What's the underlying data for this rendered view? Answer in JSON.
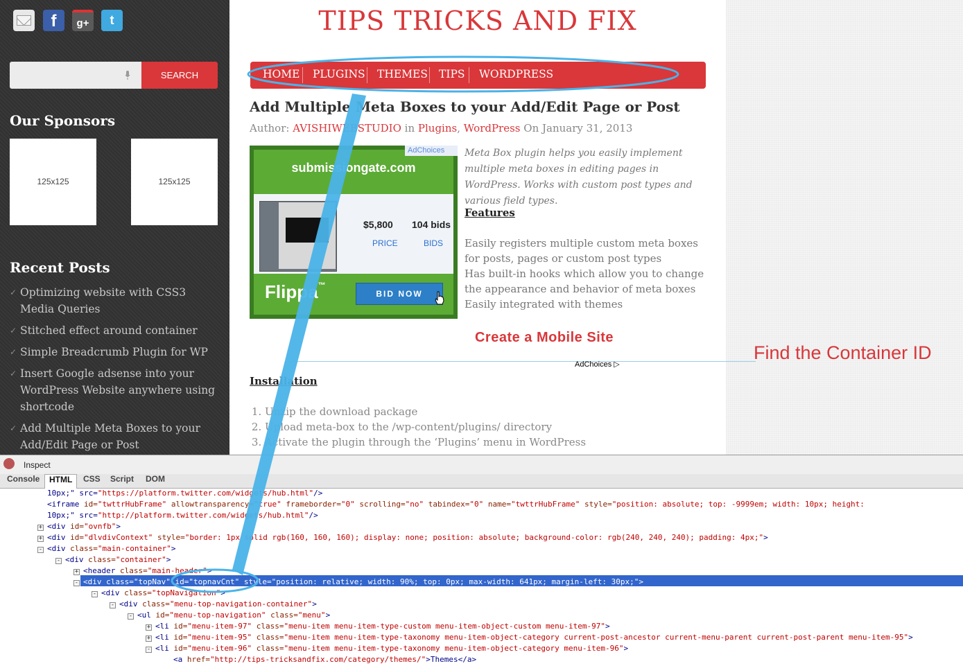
{
  "sidebar": {
    "social": [
      "email-icon",
      "facebook-icon",
      "google-plus-icon",
      "twitter-icon"
    ],
    "social_glyphs": {
      "facebook": "f",
      "google_plus": "g+",
      "twitter": "t"
    },
    "search_button": "SEARCH",
    "sponsors_heading": "Our Sponsors",
    "sponsors": [
      "125x125",
      "125x125"
    ],
    "recent_heading": "Recent Posts",
    "recent_posts": [
      "Optimizing website with CSS3 Media Queries",
      "Stitched effect around container",
      "Simple Breadcrumb Plugin for WP",
      "Insert Google adsense into your WordPress Website anywhere using shortcode",
      "Add Multiple Meta Boxes to your Add/Edit Page or Post"
    ]
  },
  "site": {
    "title": "TIPS TRICKS AND FIX",
    "nav": [
      "HOME",
      "PLUGINS",
      "THEMES",
      "TIPS",
      "WORDPRESS"
    ]
  },
  "post": {
    "title": "Add Multiple Meta Boxes to your Add/Edit Page or Post",
    "meta": {
      "author_label": "Author: ",
      "author": "AVISHIWEBSTUDIO",
      "in_label": " in ",
      "cat1": "Plugins",
      "sep": ", ",
      "cat2": "WordPress",
      "date": " On January 31, 2013"
    },
    "excerpt": "Meta Box plugin helps you easily implement multiple meta boxes in editing pages in WordPress. Works with custom post types and various field types.",
    "features_heading": "Features",
    "features": [
      "Easily registers multiple custom meta boxes for posts, pages or custom post types",
      "Has built-in hooks which allow you to change the appearance and behavior of meta boxes",
      "Easily integrated with themes"
    ],
    "mobile_link": "Create a Mobile Site",
    "adchoices": "AdChoices",
    "installation_heading": "Installation",
    "installation": [
      "Unzip the download package",
      "Upload meta-box to the /wp-content/plugins/ directory",
      "Activate the plugin through the ‘Plugins’ menu in WordPress"
    ]
  },
  "ad": {
    "adchoices": "AdChoices",
    "domain": "submissiongate.com",
    "price": "$5,800",
    "bids": "104 bids",
    "price_label": "PRICE",
    "bids_label": "BIDS",
    "brand": "Flippa",
    "brand_tm": "™",
    "button": "BID NOW"
  },
  "annotation": {
    "label": "Find the Container ID",
    "color": "#4ab3e8"
  },
  "devtools": {
    "inspect": "Inspect",
    "tabs": [
      "Console",
      "HTML",
      "CSS",
      "Script",
      "DOM"
    ],
    "active_tab": "HTML",
    "lines": [
      {
        "indent": 0,
        "tw": "",
        "t0": "10px;\" src=",
        "v0": "\"https://platform.twitter.com/widgets/hub.html\"",
        "t1": "/>"
      },
      {
        "indent": 0,
        "tw": "",
        "t0": "<iframe ",
        "a0": "id=",
        "v0": "\"twttrHubFrame\"",
        "a1": " allowtransparency=",
        "v1": "\"true\"",
        "a2": " frameborder=",
        "v2": "\"0\"",
        "a3": " scrolling=",
        "v3": "\"no\"",
        "a4": " tabindex=",
        "v4": "\"0\"",
        "a5": " name=",
        "v5": "\"twttrHubFrame\"",
        "a6": " style=",
        "v6": "\"position: absolute; top: -9999em; width: 10px; height:"
      },
      {
        "indent": 0,
        "tw": "",
        "t0": "10px;\" src=",
        "v0": "\"http://platform.twitter.com/widgets/hub.html\"",
        "t1": "/>"
      },
      {
        "indent": 0,
        "tw": "+",
        "t0": "<div ",
        "a0": "id=",
        "v0": "\"ovnfb\"",
        "t1": ">"
      },
      {
        "indent": 0,
        "tw": "+",
        "t0": "<div ",
        "a0": "id=",
        "v0": "\"dlvdivContext\"",
        "a1": " style=",
        "v1": "\"border: 1px solid rgb(160, 160, 160); display: none; position: absolute; background-color: rgb(240, 240, 240); padding: 4px;\"",
        "t1": ">"
      },
      {
        "indent": 0,
        "tw": "-",
        "t0": "<div ",
        "a0": "class=",
        "v0": "\"main-container\"",
        "t1": ">"
      },
      {
        "indent": 1,
        "tw": "-",
        "t0": "<div ",
        "a0": "class=",
        "v0": "\"container\"",
        "t1": ">"
      },
      {
        "indent": 2,
        "tw": "+",
        "t0": "<header ",
        "a0": "class=",
        "v0": "\"main-header\"",
        "t1": ">"
      },
      {
        "indent": 2,
        "tw": "-",
        "selected": true,
        "t0": "<div ",
        "a0": "class=",
        "v0": "\"topNav\"",
        "a1": " id=",
        "v1": "\"topnavCnt\"",
        "a2": " style=",
        "v2": "\"position: relative; width: 90%; top: 0px; max-width: 641px; margin-left: 30px;\"",
        "t1": ">"
      },
      {
        "indent": 3,
        "tw": "-",
        "t0": "<div ",
        "a0": "class=",
        "v0": "\"topNavigation\"",
        "t1": ">"
      },
      {
        "indent": 4,
        "tw": "-",
        "t0": "<div ",
        "a0": "class=",
        "v0": "\"menu-top-navigation-container\"",
        "t1": ">"
      },
      {
        "indent": 5,
        "tw": "-",
        "t0": "<ul ",
        "a0": "id=",
        "v0": "\"menu-top-navigation\"",
        "a1": " class=",
        "v1": "\"menu\"",
        "t1": ">"
      },
      {
        "indent": 6,
        "tw": "+",
        "t0": "<li ",
        "a0": "id=",
        "v0": "\"menu-item-97\"",
        "a1": " class=",
        "v1": "\"menu-item menu-item-type-custom menu-item-object-custom menu-item-97\"",
        "t1": ">"
      },
      {
        "indent": 6,
        "tw": "+",
        "t0": "<li ",
        "a0": "id=",
        "v0": "\"menu-item-95\"",
        "a1": " class=",
        "v1": "\"menu-item menu-item-type-taxonomy menu-item-object-category current-post-ancestor current-menu-parent current-post-parent menu-item-95\"",
        "t1": ">"
      },
      {
        "indent": 6,
        "tw": "-",
        "t0": "<li ",
        "a0": "id=",
        "v0": "\"menu-item-96\"",
        "a1": " class=",
        "v1": "\"menu-item menu-item-type-taxonomy menu-item-object-category menu-item-96\"",
        "t1": ">"
      },
      {
        "indent": 7,
        "tw": "",
        "t0": "<a ",
        "a0": "href=",
        "v0": "\"http://tips-tricksandfix.com/category/themes/\"",
        "t1": ">Themes</a>"
      }
    ]
  }
}
